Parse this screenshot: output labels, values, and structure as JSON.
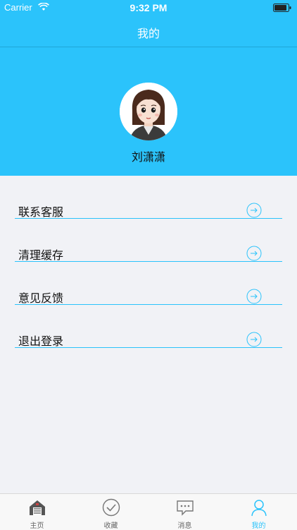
{
  "status_bar": {
    "carrier": "Carrier",
    "time": "9:32 PM"
  },
  "nav": {
    "title": "我的"
  },
  "profile": {
    "name": "刘潇潇"
  },
  "menu": {
    "items": [
      {
        "label": "联系客服"
      },
      {
        "label": "清理缓存"
      },
      {
        "label": "意见反馈"
      },
      {
        "label": "退出登录"
      }
    ]
  },
  "tabbar": {
    "items": [
      {
        "label": "主页",
        "icon": "home-icon"
      },
      {
        "label": "收藏",
        "icon": "check-circle-icon"
      },
      {
        "label": "消息",
        "icon": "chat-bubble-icon"
      },
      {
        "label": "我的",
        "icon": "person-icon",
        "active": true
      }
    ]
  },
  "colors": {
    "accent": "#2bc3fb",
    "background": "#f1f2f6"
  }
}
